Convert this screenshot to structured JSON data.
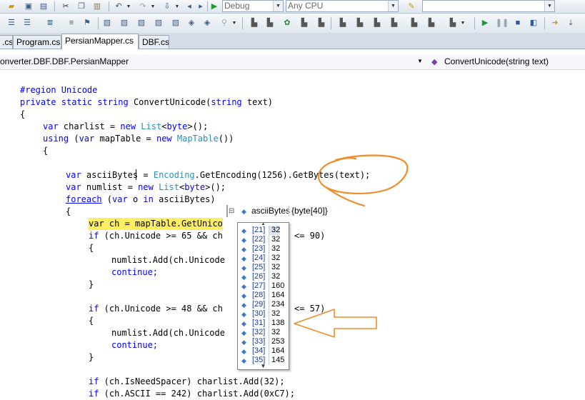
{
  "toolbar": {
    "config_value": "Debug",
    "platform_value": "Any CPU",
    "find_value": ""
  },
  "tabs": [
    {
      "label": ".cs"
    },
    {
      "label": "Program.cs"
    },
    {
      "label": "PersianMapper.cs"
    },
    {
      "label": "DBF.cs"
    }
  ],
  "nav": {
    "type_path": "onverter.DBF.DBF.PersianMapper",
    "member": "ConvertUnicode(string text)"
  },
  "code": {
    "l1": "#region Unicode",
    "l2_kw": "private static string",
    "l2_rest": " ConvertUnicode(",
    "l2_kw2": "string",
    "l2_end": " text)",
    "l3": "{",
    "l4_kw": "var",
    "l4_a": " charlist = ",
    "l4_new": "new",
    "l4_ty": " List",
    "l4_b": "<",
    "l4_byte": "byte",
    "l4_c": ">();",
    "l5_kw": "using",
    "l5_a": " (",
    "l5_var": "var",
    "l5_b": " mapTable = ",
    "l5_new": "new",
    "l5_ty": " MapTable",
    "l5_c": "())",
    "l6": "{",
    "l7_kw": "var",
    "l7_a": " asciiBytes = ",
    "l7_ty": "Encoding",
    "l7_b": ".GetEncoding(1256).GetBytes(text);",
    "l8_kw": "var",
    "l8_a": " numlist = ",
    "l8_new": "new",
    "l8_ty": " List",
    "l8_b": "<",
    "l8_byte": "byte",
    "l8_c": ">();",
    "l9_kw": "foreach",
    "l9_a": " (",
    "l9_var": "var",
    "l9_b": " o ",
    "l9_in": "in",
    "l9_c": " asciiBytes)",
    "l10": "{",
    "l11": "var ch = mapTable.GetUnico",
    "l12_kw": "if",
    "l12_a": " (ch.Unicode >= 65 && ch",
    "l12_b": "<= 90)",
    "l13": "{",
    "l14": "numlist.Add(ch.Unicode",
    "l15": "continue;",
    "l16": "}",
    "l17_kw": "if",
    "l17_a": " (ch.Unicode >= 48 && ch",
    "l17_b": "<= 57)",
    "l18": "{",
    "l19": "numlist.Add(ch.Unicode",
    "l20": "continue;",
    "l21": "}",
    "l22_kw": "if",
    "l22_a": " (ch.IsNeedSpacer) charlist.Add(32);",
    "l23_kw": "if",
    "l23_a": " (ch.ASCII == 242) charlist.Add(0xC7);"
  },
  "datatip": {
    "expand_symbol": "⊟",
    "name": "asciiBytes",
    "type": "{byte[40]}"
  },
  "array_items": [
    {
      "index": "[21]",
      "value": "32"
    },
    {
      "index": "[22]",
      "value": "32"
    },
    {
      "index": "[23]",
      "value": "32"
    },
    {
      "index": "[24]",
      "value": "32"
    },
    {
      "index": "[25]",
      "value": "32"
    },
    {
      "index": "[26]",
      "value": "32"
    },
    {
      "index": "[27]",
      "value": "160"
    },
    {
      "index": "[28]",
      "value": "164"
    },
    {
      "index": "[29]",
      "value": "234"
    },
    {
      "index": "[30]",
      "value": "32"
    },
    {
      "index": "[31]",
      "value": "138"
    },
    {
      "index": "[32]",
      "value": "32"
    },
    {
      "index": "[33]",
      "value": "253"
    },
    {
      "index": "[34]",
      "value": "164"
    },
    {
      "index": "[35]",
      "value": "145"
    }
  ],
  "annotation_color": "#f08c2a",
  "highlight_color": "#ffee62"
}
